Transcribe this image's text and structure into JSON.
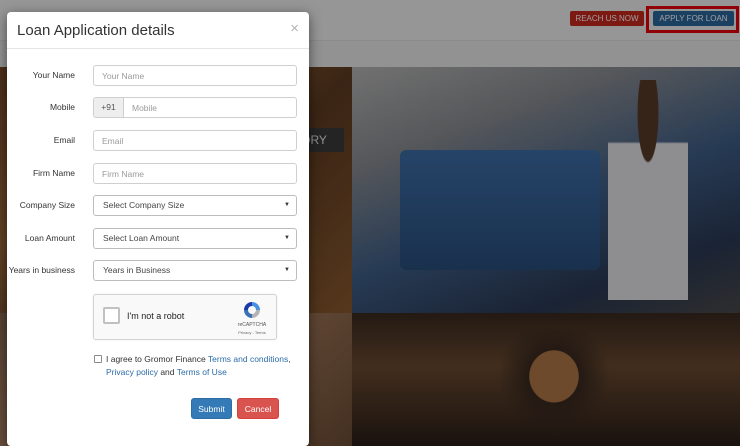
{
  "header": {
    "reach_label": "REACH US NOW",
    "apply_label": "APPLY FOR LOAN"
  },
  "background": {
    "story_fragment": "TORY"
  },
  "modal": {
    "title": "Loan Application details",
    "close_icon": "close-icon",
    "fields": [
      {
        "label": "Your Name",
        "placeholder": "Your Name"
      },
      {
        "label": "Mobile",
        "prefix": "+91",
        "placeholder": "Mobile"
      },
      {
        "label": "Email",
        "placeholder": "Email"
      },
      {
        "label": "Firm Name",
        "placeholder": "Firm Name"
      }
    ],
    "selects": [
      {
        "label": "Company Size",
        "value": "Select Company Size"
      },
      {
        "label": "Loan Amount",
        "value": "Select Loan Amount"
      },
      {
        "label": "Years in business",
        "value": "Years in Business"
      }
    ],
    "captcha": {
      "text": "I'm not a robot",
      "brand": "reCAPTCHA",
      "links": "Privacy - Terms"
    },
    "agree": {
      "prefix": "I agree to Gromor Finance ",
      "terms": "Terms and conditions",
      "comma": ",",
      "privacy": "Privacy policy",
      "and": " and ",
      "terms_of_use": "Terms of Use"
    },
    "submit_label": "Submit",
    "cancel_label": "Cancel"
  },
  "colors": {
    "primary": "#337ab7",
    "danger": "#d9534f",
    "reach_button": "#c8291f",
    "highlight": "#e8000b"
  }
}
